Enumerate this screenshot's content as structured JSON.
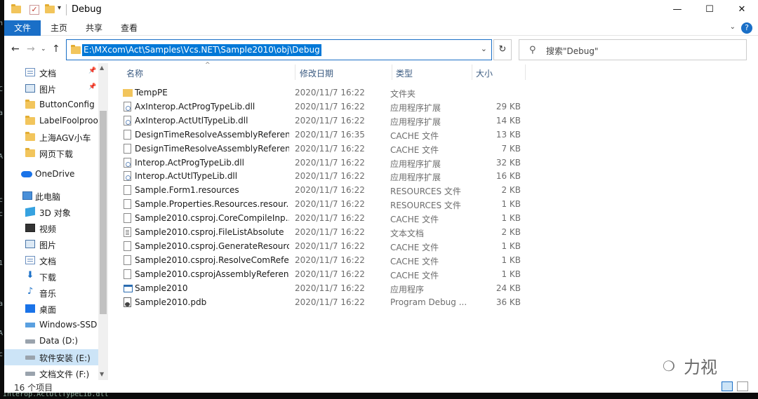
{
  "window": {
    "title": "Debug",
    "controls": {
      "minimize": "—",
      "maximize": "☐",
      "close": "✕"
    }
  },
  "ribbon": {
    "tabs": [
      "文件",
      "主页",
      "共享",
      "查看"
    ],
    "help": "?"
  },
  "address": {
    "path": "E:\\MXcom\\Act\\Samples\\Vcs.NET\\Sample2010\\obj\\Debug",
    "search_placeholder": "搜索\"Debug\""
  },
  "nav": {
    "items": [
      {
        "label": "文档",
        "icon": "documents-icon",
        "pinned": true
      },
      {
        "label": "图片",
        "icon": "pictures-icon",
        "pinned": true
      },
      {
        "label": "ButtonConfig",
        "icon": "folder-icon"
      },
      {
        "label": "LabelFoolproo",
        "icon": "folder-icon"
      },
      {
        "label": "上海AGV小车",
        "icon": "folder-icon"
      },
      {
        "label": "网页下载",
        "icon": "folder-icon"
      },
      {
        "label": "OneDrive",
        "icon": "onedrive-icon"
      },
      {
        "label": "此电脑",
        "icon": "this-pc-icon"
      },
      {
        "label": "3D 对象",
        "icon": "3d-objects-icon"
      },
      {
        "label": "视频",
        "icon": "videos-icon"
      },
      {
        "label": "图片",
        "icon": "pictures-icon"
      },
      {
        "label": "文档",
        "icon": "documents-icon"
      },
      {
        "label": "下载",
        "icon": "downloads-icon"
      },
      {
        "label": "音乐",
        "icon": "music-icon"
      },
      {
        "label": "桌面",
        "icon": "desktop-icon"
      },
      {
        "label": "Windows-SSD",
        "icon": "windows-drive-icon"
      },
      {
        "label": "Data (D:)",
        "icon": "drive-icon"
      },
      {
        "label": "软件安装 (E:)",
        "icon": "drive-icon",
        "selected": true
      },
      {
        "label": "文档文件 (F:)",
        "icon": "drive-icon"
      }
    ]
  },
  "columns": {
    "name": "名称",
    "date": "修改日期",
    "type": "类型",
    "size": "大小"
  },
  "files": [
    {
      "name": "TempPE",
      "date": "2020/11/7 16:22",
      "type": "文件夹",
      "size": "",
      "icon": "folder"
    },
    {
      "name": "AxInterop.ActProgTypeLib.dll",
      "date": "2020/11/7 16:22",
      "type": "应用程序扩展",
      "size": "29 KB",
      "icon": "dll"
    },
    {
      "name": "AxInterop.ActUtlTypeLib.dll",
      "date": "2020/11/7 16:22",
      "type": "应用程序扩展",
      "size": "14 KB",
      "icon": "dll"
    },
    {
      "name": "DesignTimeResolveAssemblyReferen...",
      "date": "2020/11/7 16:35",
      "type": "CACHE 文件",
      "size": "13 KB",
      "icon": "file"
    },
    {
      "name": "DesignTimeResolveAssemblyReferen...",
      "date": "2020/11/7 16:22",
      "type": "CACHE 文件",
      "size": "7 KB",
      "icon": "file"
    },
    {
      "name": "Interop.ActProgTypeLib.dll",
      "date": "2020/11/7 16:22",
      "type": "应用程序扩展",
      "size": "32 KB",
      "icon": "dll"
    },
    {
      "name": "Interop.ActUtlTypeLib.dll",
      "date": "2020/11/7 16:22",
      "type": "应用程序扩展",
      "size": "16 KB",
      "icon": "dll"
    },
    {
      "name": "Sample.Form1.resources",
      "date": "2020/11/7 16:22",
      "type": "RESOURCES 文件",
      "size": "2 KB",
      "icon": "file"
    },
    {
      "name": "Sample.Properties.Resources.resour...",
      "date": "2020/11/7 16:22",
      "type": "RESOURCES 文件",
      "size": "1 KB",
      "icon": "file"
    },
    {
      "name": "Sample2010.csproj.CoreCompileInp...",
      "date": "2020/11/7 16:22",
      "type": "CACHE 文件",
      "size": "1 KB",
      "icon": "file"
    },
    {
      "name": "Sample2010.csproj.FileListAbsolute",
      "date": "2020/11/7 16:22",
      "type": "文本文档",
      "size": "2 KB",
      "icon": "txt"
    },
    {
      "name": "Sample2010.csproj.GenerateResourc...",
      "date": "2020/11/7 16:22",
      "type": "CACHE 文件",
      "size": "1 KB",
      "icon": "file"
    },
    {
      "name": "Sample2010.csproj.ResolveComRefe...",
      "date": "2020/11/7 16:22",
      "type": "CACHE 文件",
      "size": "1 KB",
      "icon": "file"
    },
    {
      "name": "Sample2010.csprojAssemblyReferen...",
      "date": "2020/11/7 16:22",
      "type": "CACHE 文件",
      "size": "1 KB",
      "icon": "file"
    },
    {
      "name": "Sample2010",
      "date": "2020/11/7 16:22",
      "type": "应用程序",
      "size": "24 KB",
      "icon": "exe"
    },
    {
      "name": "Sample2010.pdb",
      "date": "2020/11/7 16:22",
      "type": "Program Debug ...",
      "size": "36 KB",
      "icon": "pdb"
    }
  ],
  "status": {
    "count": "16 个项目"
  },
  "watermark": {
    "text": "力视"
  },
  "background": {
    "bottom_text": "Interop.ActUtlTypeLib.dll",
    "left_chars": [
      "n",
      "C",
      "a",
      "A",
      "c",
      "c",
      "1",
      "a",
      "A",
      "c"
    ]
  },
  "colors": {
    "accent": "#1a6fc7",
    "selection": "#cce4f7",
    "address_highlight": "#0078d7",
    "folder": "#f2c55c"
  }
}
